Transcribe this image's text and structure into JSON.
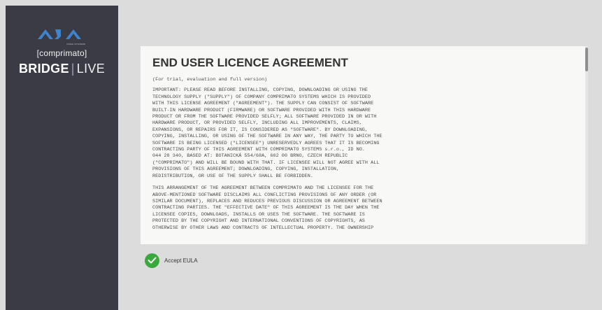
{
  "brand": {
    "logo_text": "AJA",
    "logo_sub": "VIDEO SYSTEMS",
    "comprimato": "[comprimato]",
    "product_part1": "BRIDGE",
    "product_sep": "|",
    "product_part2": "LIVE",
    "accent_color": "#3f84cf"
  },
  "eula": {
    "title": "END USER LICENCE AGREEMENT",
    "subtitle": "(For trial, evaluation and full version)",
    "paragraph1": "IMPORTANT: PLEASE READ BEFORE INSTALLING, COPYING, DOWNLOADING OR USING THE\nTECHNOLOGY SUPPLY (\"SUPPLY\") OF COMPANY COMPRIMATO SYSTEMS WHICH IS PROVIDED\nWITH THIS LICENSE AGREEMENT (\"AGREEMENT\"). THE SUPPLY CAN CONSIST OF SOFTWARE\nBUILT-IN HARDWARE PRODUCT (FIRMWARE) OR SOFTWARE PROVIDED WITH THIS HARDWARE\nPRODUCT OR FROM THE SOFTWARE PROVIDED SELFLY; ALL SOFTWARE PROVIDED IN OR WITH\nHARDWARE PRODUCT, OR PROVIDED SELFLY, INCLUDING ALL IMPROVEMENTS, CLAIMS,\nEXPANSIONS, OR REPAIRS FOR IT, IS CONSIDERED AS \"SOFTWARE\". BY DOWNLOADING,\nCOPYING, INSTALLING, OR USING OF THE SOFTWARE IN ANY WAY, THE PARTY TO WHICH THE\nSOFTWARE IS BEING LICENSED (\"LICENSEE\") UNRESERVEDLY AGREES THAT IT IS BECOMING\nCONTRACTING PARTY OF THIS AGREEMENT WITH COMPRIMATO SYSTEMS s.r.o., ID NO.\n044 28 340, BASED AT: BOTANICKÁ 554/68A, 602 00 BRNO, CZECH REPUBLIC\n(\"COMPRIMATO\") AND WILL BE BOUND WITH THAT. IF LICENSEE WILL NOT AGREE WITH ALL\nPROVISIONS OF THIS AGREEMENT; DOWNLOADING, COPYING, INSTALLATION,\nREDISTRIBUTION, OR USE OF THE SUPPLY SHALL BE FORBIDDEN.",
    "paragraph2": "THIS ARRANGEMENT OF THE AGREEMENT BETWEEN COMPRIMATO AND THE LICENSEE FOR THE\nABOVE-MENTIONED SOFTWARE DISCLAIMS ALL CONFLICTING PROVISIONS OF ANY ORDER (OR\nSIMILAR DOCUMENT), REPLACES AND REDUCES PREVIOUS DISCUSSION OR AGREEMENT BETWEEN\nCONTRACTING PARTIES. THE \"EFFECTIVE DATE\" OF THIS AGREEMENT IS THE DAY WHEN THE\nLICENSEE COPIES, DOWNLOADS, INSTALLS OR USES THE SOFTWARE. THE SOFTWARE IS\nPROTECTED BY THE COPYRIGHT AND INTERNATIONAL CONVENTIONS OF COPYRIGHTS, AS\nOTHERWISE BY OTHER LAWS AND CONTRACTS OF INTELLECTUAL PROPERTY. THE OWNERSHIP"
  },
  "accept": {
    "label": "Accept EULA",
    "checked": true,
    "check_color": "#3aa93d"
  }
}
